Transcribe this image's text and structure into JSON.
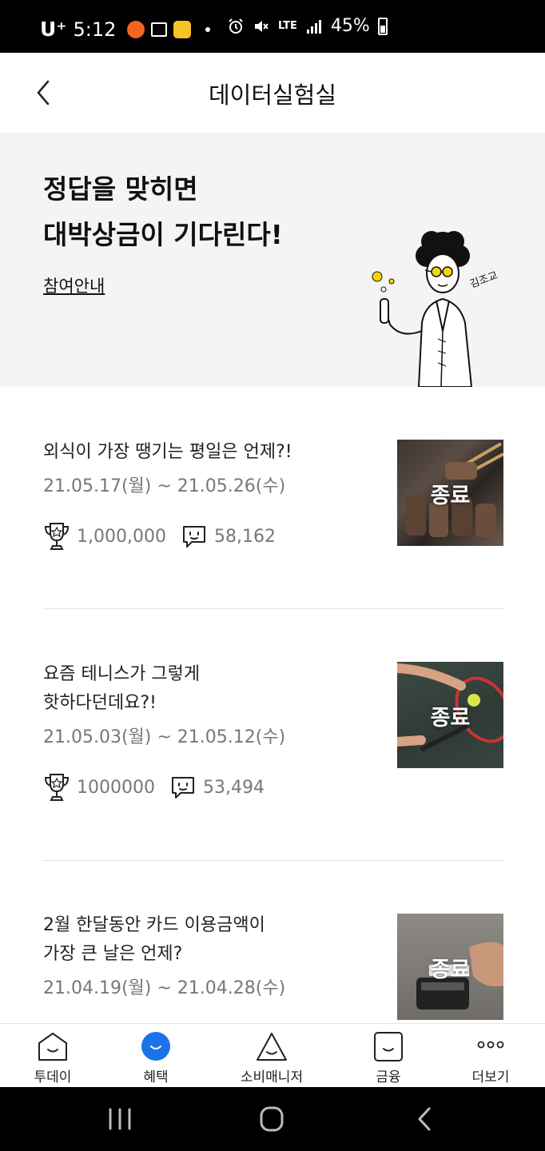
{
  "status_bar": {
    "carrier": "U⁺",
    "time": "5:12",
    "network": "LTE",
    "battery": "45%"
  },
  "header": {
    "title": "데이터실험실"
  },
  "banner": {
    "title_line1": "정답을 맞히면",
    "title_line2": "대박상금이 기다린다!",
    "guide_link": "참여안내",
    "character_label": "김조교"
  },
  "items": [
    {
      "title": "외식이 가장 땡기는 평일은 언제?!",
      "title_line2": "",
      "period": "21.05.17(월) ~ 21.05.26(수)",
      "prize": "1,000,000",
      "comments": "58,162",
      "badge": "종료"
    },
    {
      "title": "요즘 테니스가 그렇게",
      "title_line2": "핫하다던데요?!",
      "period": "21.05.03(월) ~ 21.05.12(수)",
      "prize": "1000000",
      "comments": "53,494",
      "badge": "종료"
    },
    {
      "title": "2월 한달동안 카드 이용금액이",
      "title_line2": "가장 큰 날은 언제?",
      "period": "21.04.19(월) ~ 21.04.28(수)",
      "badge": "종료"
    }
  ],
  "bottom_nav": {
    "items": [
      {
        "label": "투데이",
        "icon": "home-face-icon"
      },
      {
        "label": "혜택",
        "icon": "benefit-face-icon"
      },
      {
        "label": "소비매니저",
        "icon": "triangle-face-icon"
      },
      {
        "label": "금융",
        "icon": "square-face-icon"
      },
      {
        "label": "더보기",
        "icon": "more-dots-icon"
      }
    ],
    "active_index": 1,
    "active_color": "#1a73e8"
  }
}
